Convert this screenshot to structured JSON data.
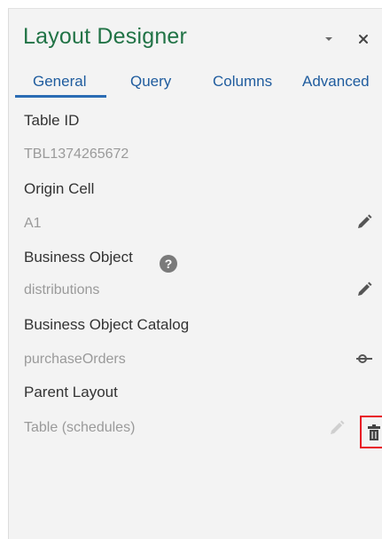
{
  "panel": {
    "title": "Layout Designer",
    "dropdown_icon": "caret-down-icon",
    "close_icon": "close-icon"
  },
  "tabs": [
    {
      "label": "General",
      "active": true
    },
    {
      "label": "Query",
      "active": false
    },
    {
      "label": "Columns",
      "active": false
    },
    {
      "label": "Advanced",
      "active": false
    }
  ],
  "properties": {
    "table_id": {
      "label": "Table ID",
      "value": "TBL1374265672"
    },
    "origin_cell": {
      "label": "Origin Cell",
      "value": "A1",
      "action_icon": "pencil-icon"
    },
    "business_object": {
      "label": "Business Object",
      "help_glyph": "?",
      "value": "distributions",
      "action_icon": "pencil-icon"
    },
    "business_object_catalog": {
      "label": "Business Object Catalog",
      "value": "purchaseOrders",
      "action_icon": "catalog-key-icon"
    },
    "parent_layout": {
      "label": "Parent Layout",
      "value": "Table (schedules)",
      "edit_icon": "pencil-icon",
      "delete_icon": "trash-icon"
    }
  },
  "colors": {
    "title": "#217346",
    "tab_text": "#1f5c9e",
    "tab_underline": "#2b6cb4",
    "highlight": "#e81123",
    "pane_bg": "#f3f3f3"
  }
}
